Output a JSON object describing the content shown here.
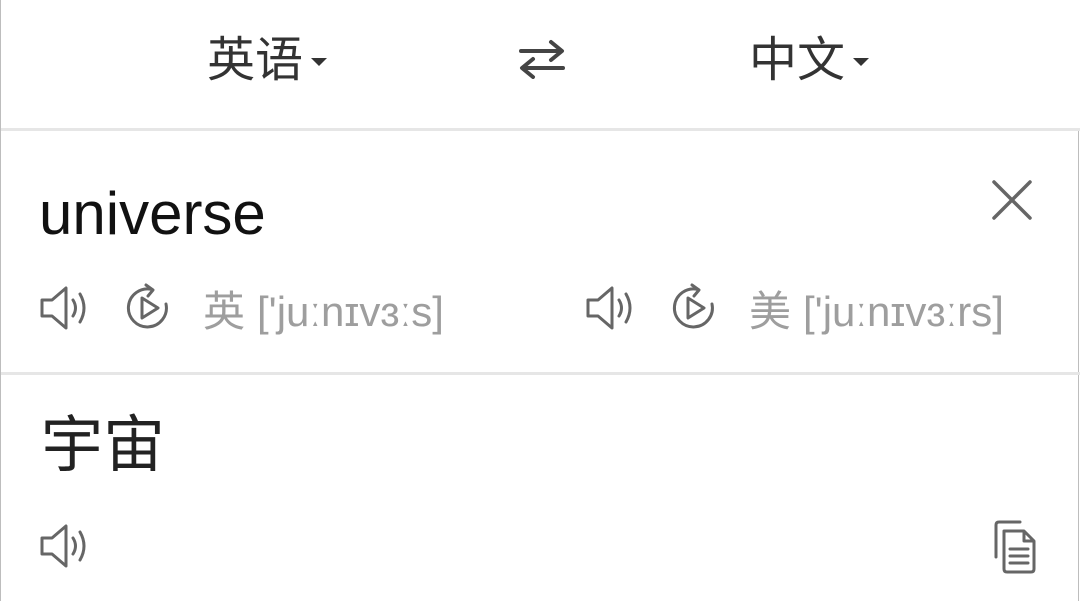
{
  "language_bar": {
    "source_language": "英语",
    "target_language": "中文"
  },
  "source": {
    "text": "universe",
    "uk": {
      "region": "英",
      "phonetic": "['juːnɪvɜːs]"
    },
    "us": {
      "region": "美",
      "phonetic": "['juːnɪvɜːrs]"
    }
  },
  "result": {
    "text": "宇宙"
  },
  "colors": {
    "text_primary": "#222222",
    "text_secondary": "#9e9e9e",
    "icon": "#666666",
    "divider": "#e6e6e6"
  },
  "icons": {
    "swap": "swap-arrows-icon",
    "clear": "close-icon",
    "speak": "speaker-icon",
    "replay": "replay-icon",
    "copy": "copy-icon"
  }
}
